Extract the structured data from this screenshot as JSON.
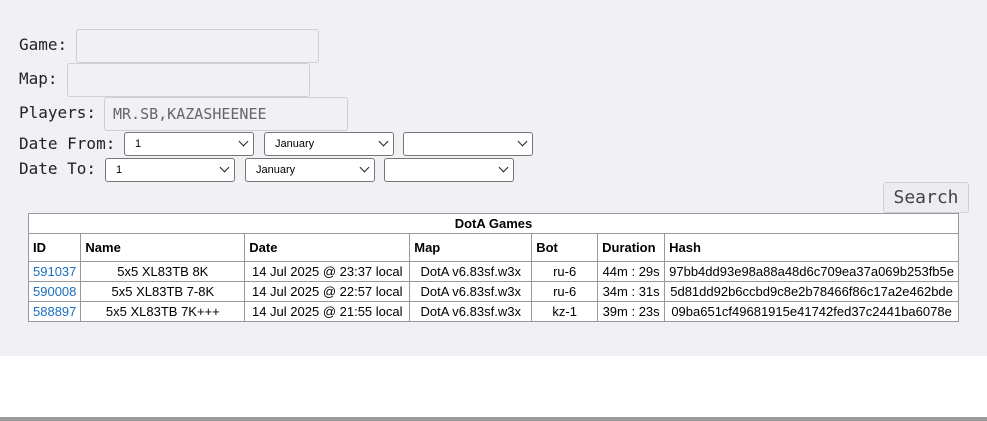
{
  "form": {
    "game_label": "Game:",
    "game_value": "",
    "map_label": "Map:",
    "map_value": "",
    "players_label": "Players:",
    "players_value": "MR.SB,KAZASHEENEE",
    "date_from_label": "Date From:",
    "date_from_day": "1",
    "date_from_month": "January",
    "date_from_year": "",
    "date_to_label": "Date To:",
    "date_to_day": "1",
    "date_to_month": "January",
    "date_to_year": "",
    "search_label": "Search"
  },
  "table": {
    "caption": "DotA Games",
    "headers": [
      "ID",
      "Name",
      "Date",
      "Map",
      "Bot",
      "Duration",
      "Hash"
    ],
    "rows": [
      {
        "id": "591037",
        "name": "5x5 XL83TB 8K",
        "date": "14 Jul 2025 @ 23:37 local",
        "map": "DotA v6.83sf.w3x",
        "bot": "ru-6",
        "duration": "44m : 29s",
        "hash": "97bb4dd93e98a88a48d6c709ea37a069b253fb5e"
      },
      {
        "id": "590008",
        "name": "5x5 XL83TB 7-8K",
        "date": "14 Jul 2025 @ 22:57 local",
        "map": "DotA v6.83sf.w3x",
        "bot": "ru-6",
        "duration": "34m : 31s",
        "hash": "5d81dd92b6ccbd9c8e2b78466f86c17a2e462bde"
      },
      {
        "id": "588897",
        "name": "5x5 XL83TB 7K+++",
        "date": "14 Jul 2025 @ 21:55 local",
        "map": "DotA v6.83sf.w3x",
        "bot": "kz-1",
        "duration": "39m : 23s",
        "hash": "09ba651cf49681915e41742fed37c2441ba6078e"
      }
    ]
  }
}
